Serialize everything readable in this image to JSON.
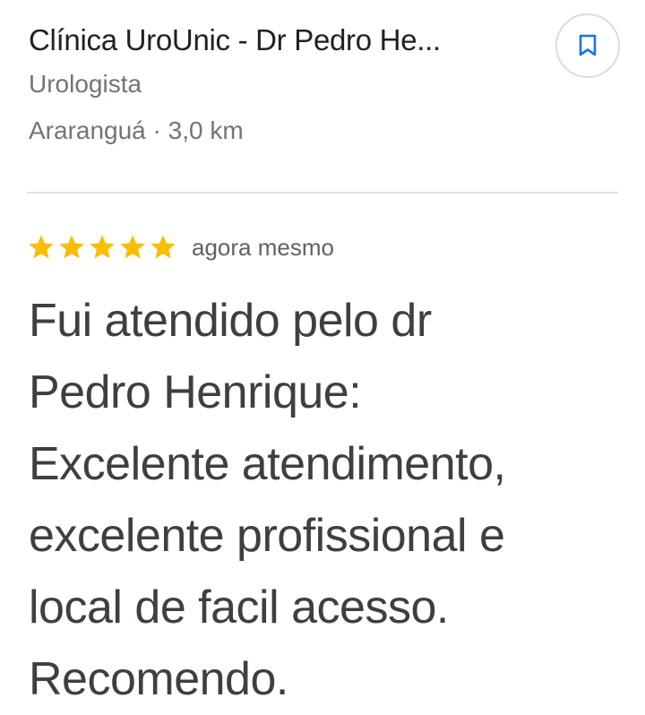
{
  "place": {
    "name": "Clínica UroUnic - Dr Pedro He...",
    "category": "Urologista",
    "location": "Araranguá · 3,0 km"
  },
  "save_button": {
    "icon": "bookmark-icon",
    "accent_color": "#1a73e8"
  },
  "review": {
    "rating": 5,
    "rating_max": 5,
    "star_color": "#fbbc04",
    "time": "agora mesmo",
    "text": "Fui atendido pelo dr\nPedro Henrique:\nExcelente atendimento,\nexcelente profissional e\nlocal de facil acesso.\nRecomendo."
  }
}
